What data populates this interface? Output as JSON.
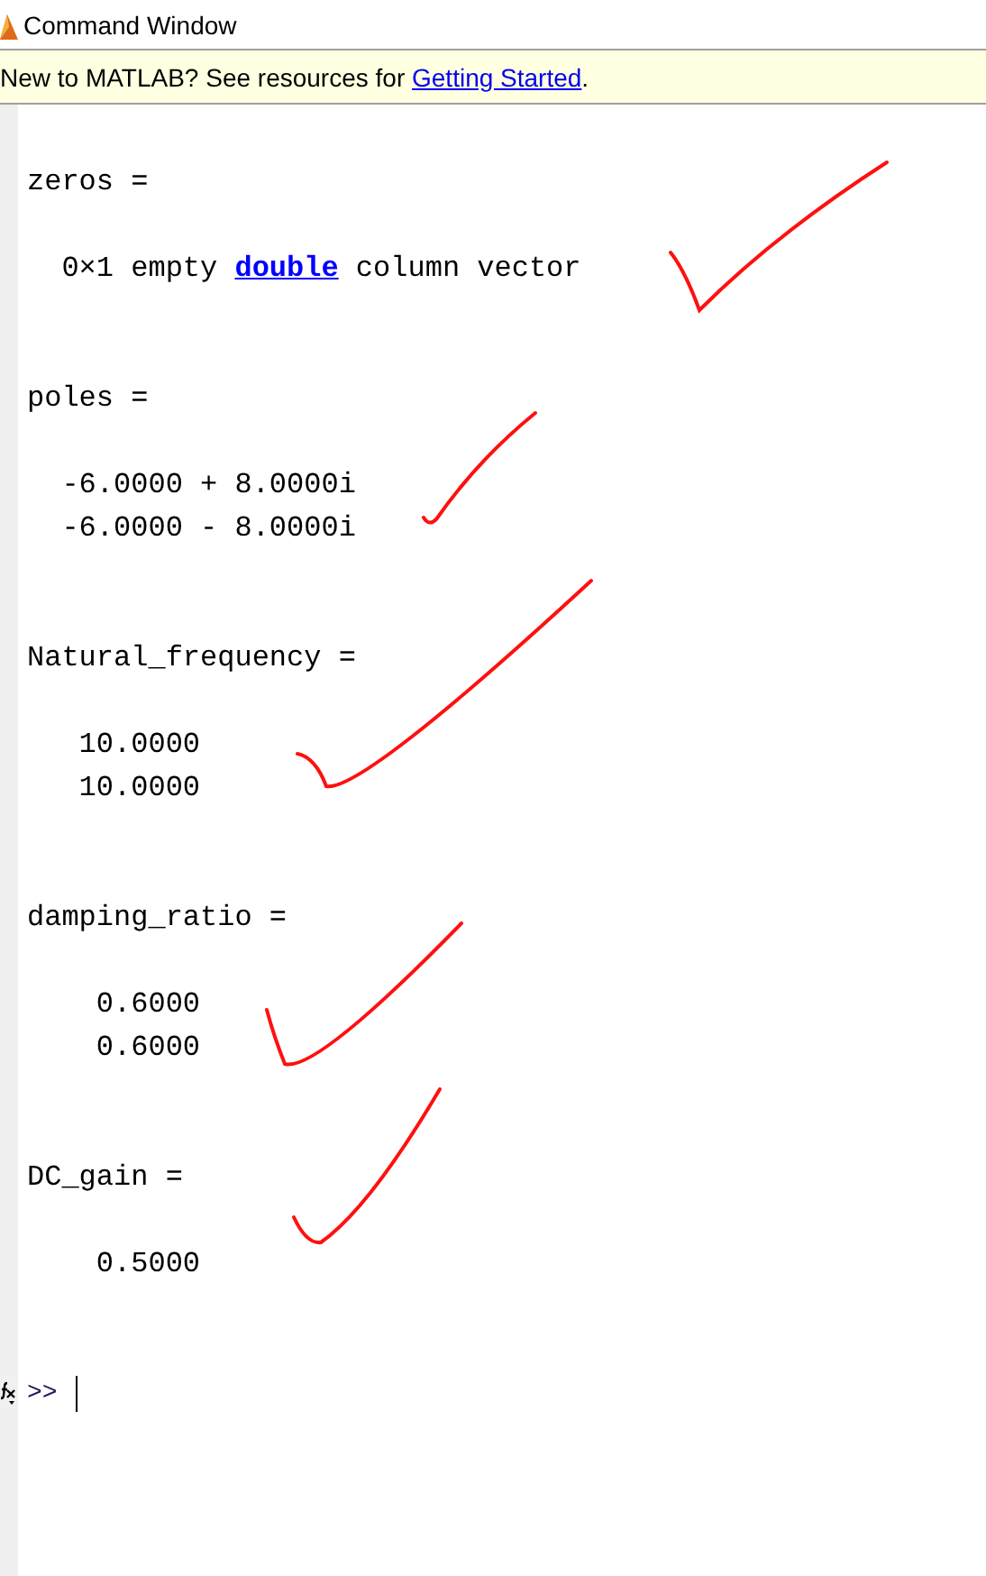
{
  "window": {
    "title": "Command Window"
  },
  "banner": {
    "text": "New to MATLAB? See resources for ",
    "link": "Getting Started",
    "after": "."
  },
  "outputs": [
    {
      "name": "zeros =",
      "checked": true,
      "values": [
        {
          "kind": "link",
          "before": "  0×1 empty ",
          "link": "double",
          "after": " column vector"
        }
      ]
    },
    {
      "name": "poles =",
      "checked": true,
      "values": [
        {
          "kind": "text",
          "text": "  -6.0000 + 8.0000i"
        },
        {
          "kind": "text",
          "text": "  -6.0000 - 8.0000i"
        }
      ]
    },
    {
      "name": "Natural_frequency =",
      "checked": true,
      "values": [
        {
          "kind": "text",
          "text": "   10.0000"
        },
        {
          "kind": "text",
          "text": "   10.0000"
        }
      ]
    },
    {
      "name": "damping_ratio =",
      "checked": true,
      "values": [
        {
          "kind": "text",
          "text": "    0.6000"
        },
        {
          "kind": "text",
          "text": "    0.6000"
        }
      ]
    },
    {
      "name": "DC_gain =",
      "checked": true,
      "values": [
        {
          "kind": "text",
          "text": "    0.5000"
        }
      ]
    }
  ],
  "prompt": {
    "symbol": ">>"
  }
}
